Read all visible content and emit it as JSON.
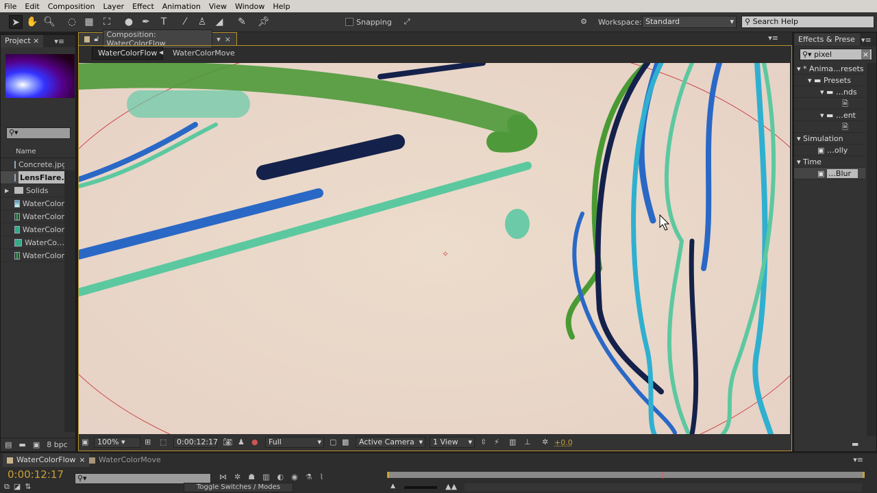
{
  "menu": [
    "File",
    "Edit",
    "Composition",
    "Layer",
    "Effect",
    "Animation",
    "View",
    "Window",
    "Help"
  ],
  "toolbar": {
    "snapping": "Snapping",
    "workspace_label": "Workspace:",
    "workspace_value": "Standard",
    "search_help": "Search Help"
  },
  "project": {
    "tab": "Project",
    "col_name": "Name",
    "items": [
      {
        "name": "Concrete.jpg",
        "type": "image"
      },
      {
        "name": "LensFlare.",
        "type": "image",
        "selected": true
      },
      {
        "name": "Solids",
        "type": "folder"
      },
      {
        "name": "WaterColor",
        "type": "image"
      },
      {
        "name": "WaterColor",
        "type": "comp"
      },
      {
        "name": "WaterColor",
        "type": "footage"
      },
      {
        "name": "WaterCo…",
        "type": "footage"
      },
      {
        "name": "WaterColor",
        "type": "comp"
      }
    ],
    "bpc": "8 bpc"
  },
  "composition": {
    "tab": "Composition: WaterColorFlow",
    "breadcrumbs": [
      "WaterColorFlow",
      "WaterColorMove"
    ],
    "footer": {
      "zoom": "100%",
      "timecode": "0:00:12:17",
      "resolution": "Full",
      "camera": "Active Camera",
      "views": "1 View",
      "exposure": "+0.0"
    }
  },
  "effects": {
    "tab": "Effects & Prese",
    "search": "pixel",
    "tree": [
      {
        "label": "* Anima…resets",
        "level": 0,
        "kind": "group"
      },
      {
        "label": "Presets",
        "level": 1,
        "kind": "folder"
      },
      {
        "label": "…nds",
        "level": 2,
        "kind": "folder"
      },
      {
        "label": "",
        "level": 3,
        "kind": "fx"
      },
      {
        "label": "…ent",
        "level": 2,
        "kind": "folder"
      },
      {
        "label": "",
        "level": 3,
        "kind": "fx"
      },
      {
        "label": "Simulation",
        "level": 0,
        "kind": "group"
      },
      {
        "label": "…olly",
        "level": 2,
        "kind": "effect"
      },
      {
        "label": "Time",
        "level": 0,
        "kind": "group"
      },
      {
        "label": "…Blur",
        "level": 2,
        "kind": "effect",
        "selected": true
      }
    ]
  },
  "timeline": {
    "tabs": [
      "WaterColorFlow",
      "WaterColorMove"
    ],
    "timecode": "0:00:12:17",
    "toggle": "Toggle Switches / Modes"
  }
}
